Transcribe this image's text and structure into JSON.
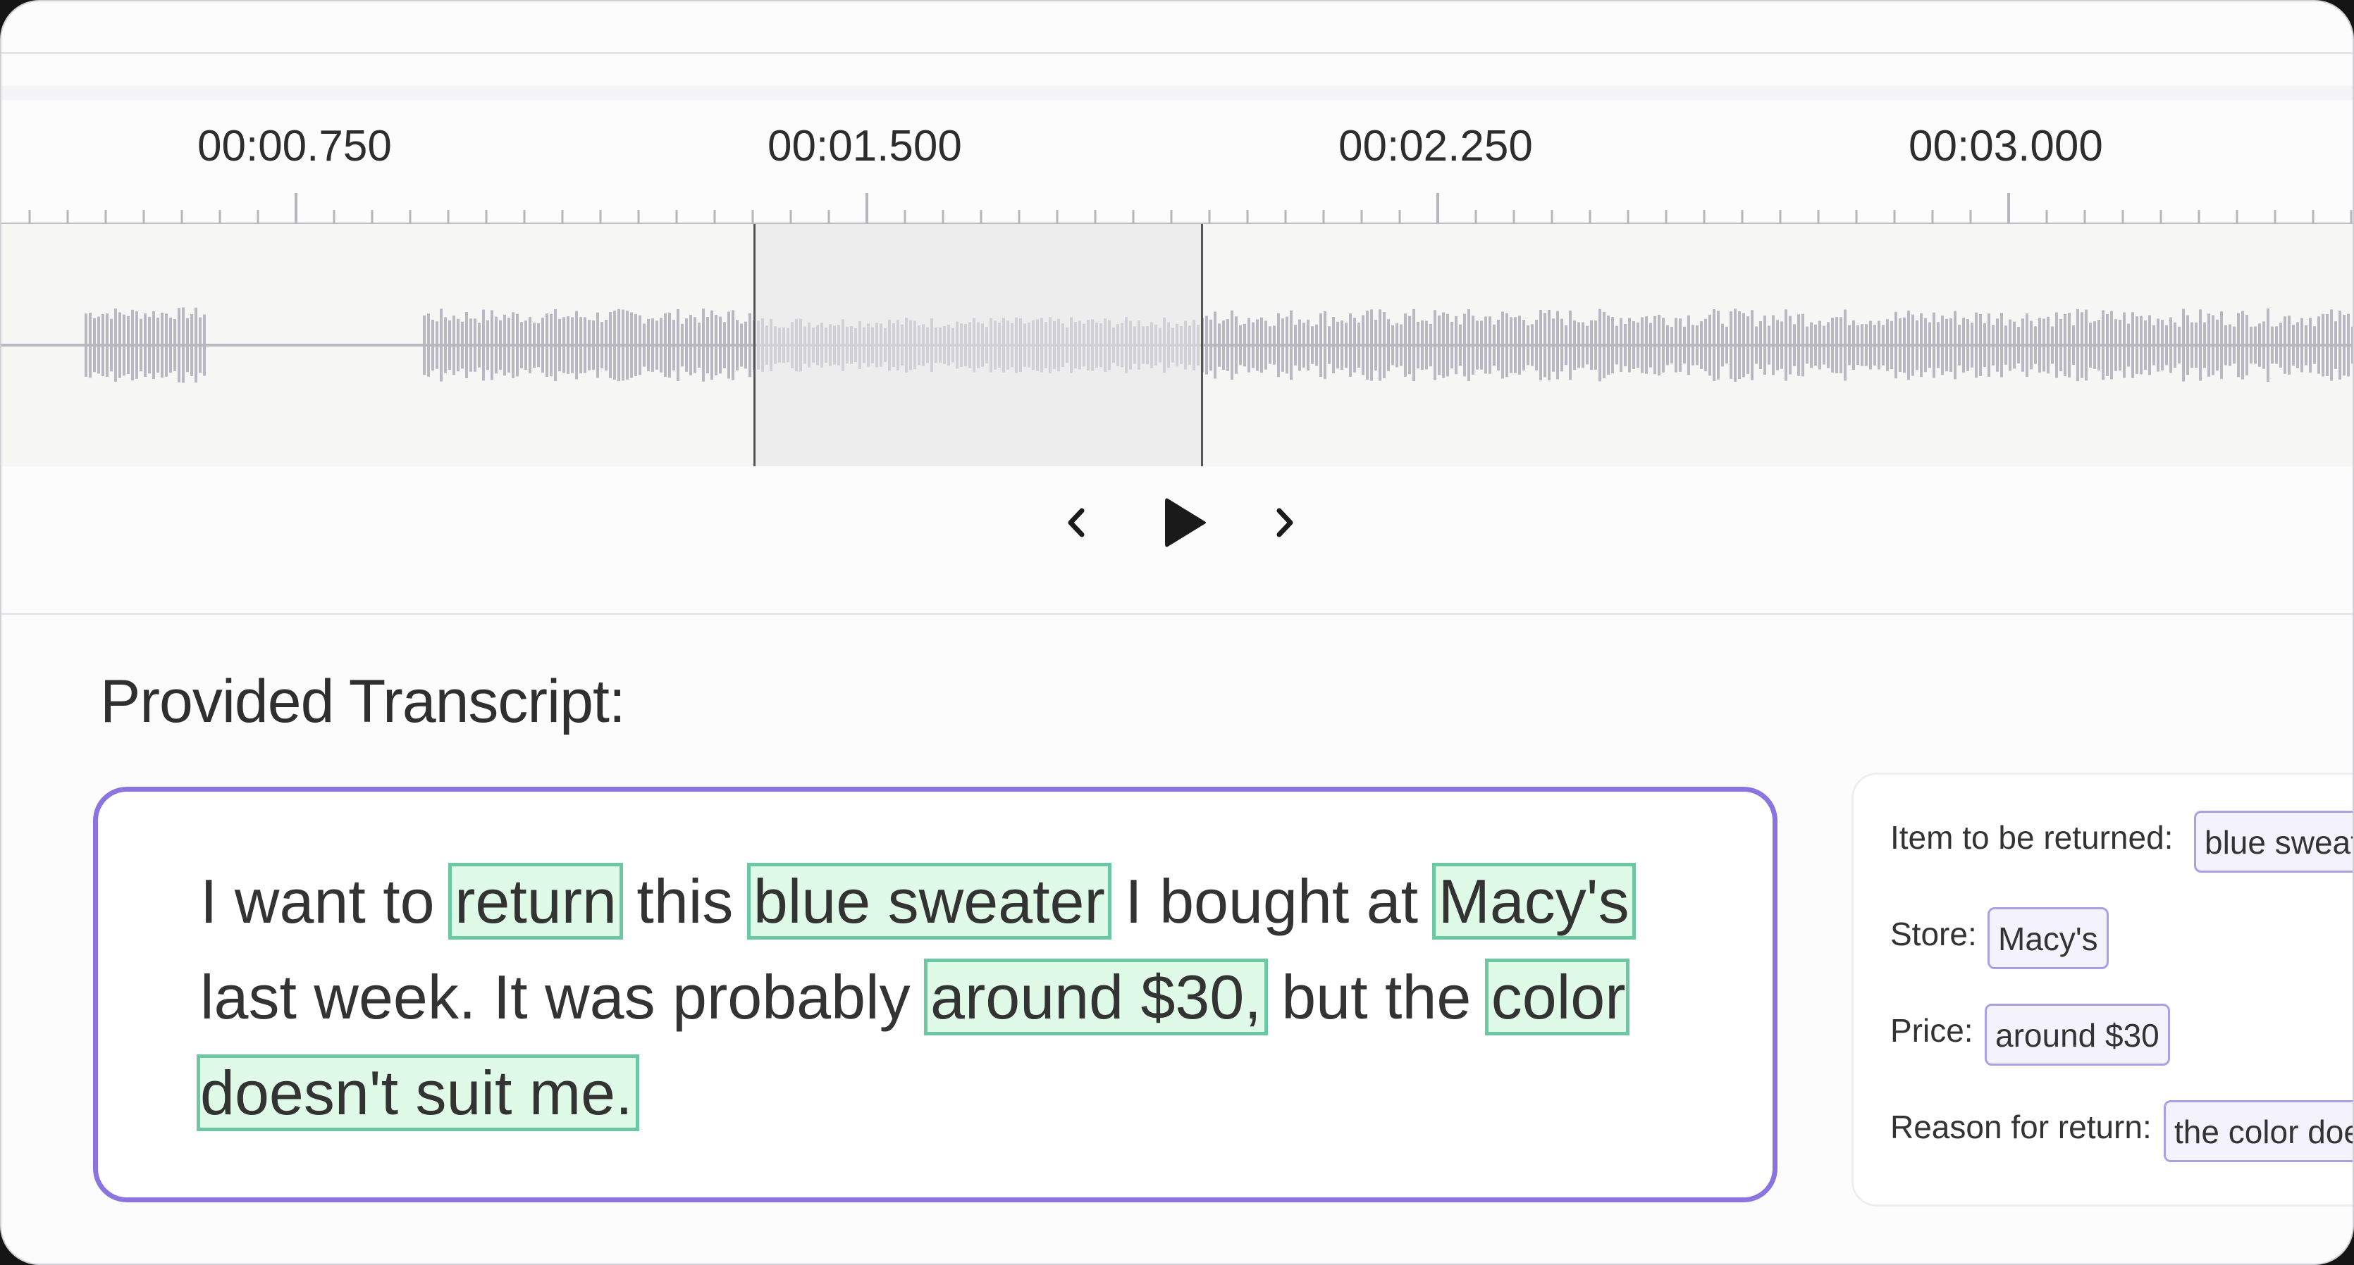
{
  "timeline": {
    "tick_labels": [
      "00:00.750",
      "00:01.500",
      "00:02.250",
      "00:03.000"
    ]
  },
  "player": {
    "prev_icon": "chevron-left-icon",
    "play_icon": "play-icon",
    "next_icon": "chevron-right-icon"
  },
  "transcript": {
    "heading": "Provided Transcript:",
    "segments": [
      {
        "text": "I want to ",
        "highlight": false
      },
      {
        "text": "return",
        "highlight": true
      },
      {
        "text": " this ",
        "highlight": false
      },
      {
        "text": "blue sweater",
        "highlight": true
      },
      {
        "text": " I bought at ",
        "highlight": false
      },
      {
        "text": "Macy's",
        "highlight": true
      },
      {
        "text": " last week. It was probably ",
        "highlight": false
      },
      {
        "text": "around $30,",
        "highlight": true
      },
      {
        "text": " but the ",
        "highlight": false
      },
      {
        "text": "color doesn't suit me.",
        "highlight": true
      }
    ]
  },
  "fields": [
    {
      "label": "Item to be returned:",
      "value": "blue sweater"
    },
    {
      "label": "Store:",
      "value": "Macy's"
    },
    {
      "label": "Price:",
      "value": "around $30"
    },
    {
      "label": "Reason for return:",
      "value": "the color doesn't suit me"
    }
  ],
  "colors": {
    "accent": "#8b74e0",
    "highlight_fill": "#dffbe7",
    "highlight_border": "#6cc8a2",
    "waveform": "#b9b7c2"
  }
}
